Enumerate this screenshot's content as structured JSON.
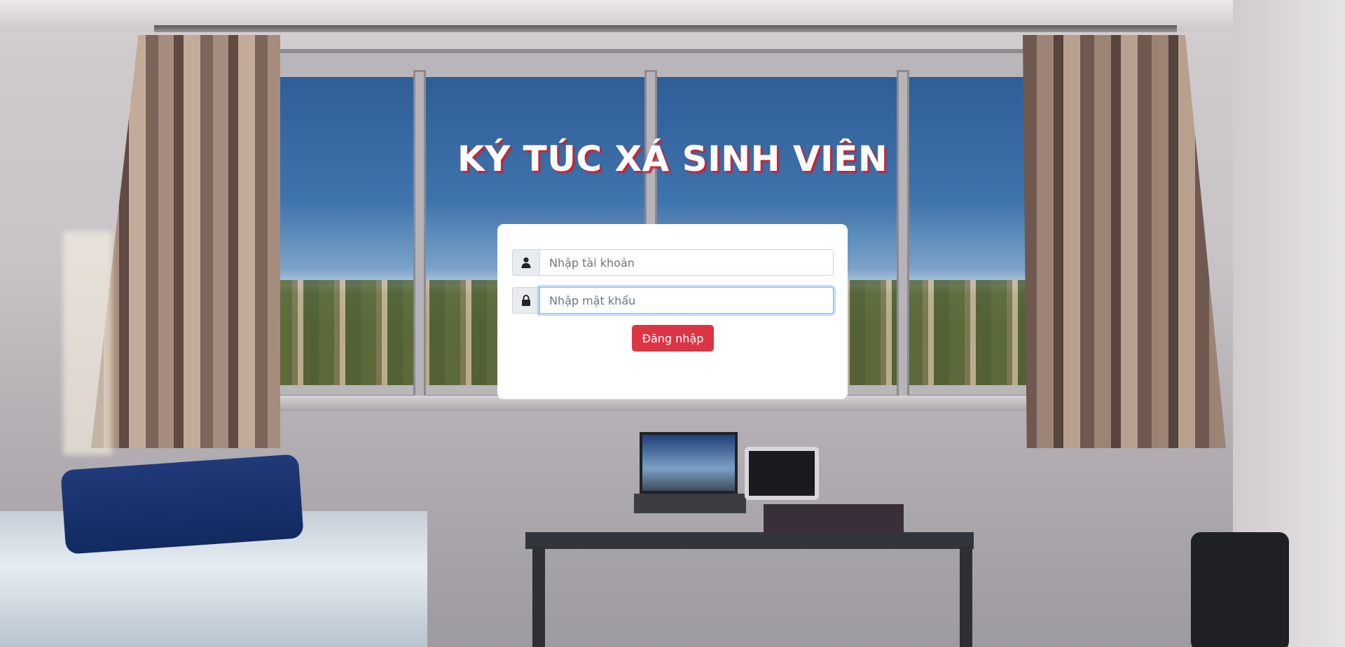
{
  "page": {
    "title": "KÝ TÚC XÁ SINH VIÊN"
  },
  "login": {
    "username": {
      "icon": "user-icon",
      "placeholder": "Nhập tài khoản",
      "value": ""
    },
    "password": {
      "icon": "lock-icon",
      "placeholder": "Nhập mật khẩu",
      "value": ""
    },
    "submit_label": "Đăng nhập"
  },
  "colors": {
    "accent": "#dc3545",
    "title_text": "#ffffff",
    "title_shadow": "#c82333",
    "focus_border": "#80bdff"
  }
}
